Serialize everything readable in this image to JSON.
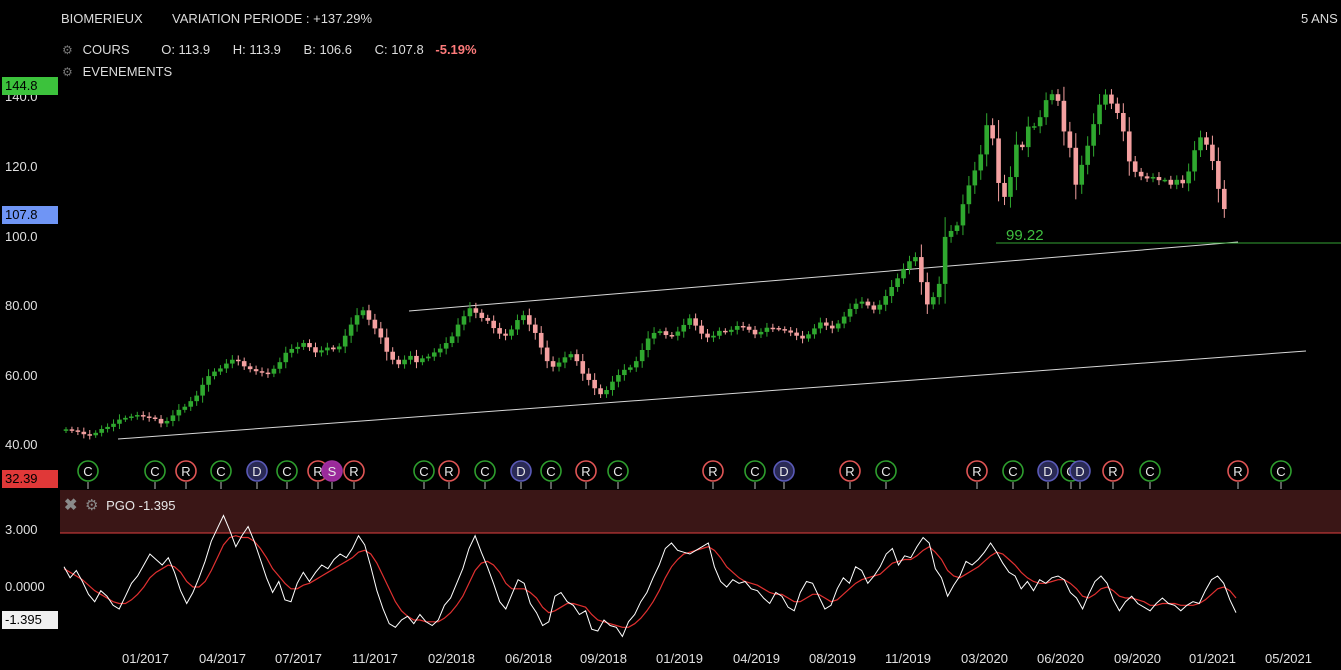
{
  "header": {
    "ticker": "BIOMERIEUX",
    "variation": "VARIATION PERIODE : +137.29%",
    "period": "5 ANS"
  },
  "legend": {
    "cours_label": "COURS",
    "open": "O: 113.9",
    "high": "H: 113.9",
    "low": "B: 106.6",
    "close": "C: 107.8",
    "change": "-5.19%",
    "events_label": "EVENEMENTS"
  },
  "price_axis": {
    "ticks": [
      "140.0",
      "120.0",
      "100.0",
      "80.00",
      "60.00",
      "40.00"
    ],
    "high_tag": "144.8",
    "last_tag": "107.8",
    "low_tag": "32.39",
    "level_label": "99.22"
  },
  "pgo_panel": {
    "label": "PGO -1.395",
    "ticks": [
      "3.000",
      "0.0000"
    ],
    "value_tag": "-1.395"
  },
  "time_axis": [
    "01/2017",
    "04/2017",
    "07/2017",
    "11/2017",
    "02/2018",
    "06/2018",
    "09/2018",
    "01/2019",
    "04/2019",
    "08/2019",
    "11/2019",
    "03/2020",
    "06/2020",
    "09/2020",
    "01/2021",
    "05/2021"
  ],
  "colors": {
    "up": "#2fa82f",
    "down": "#f4a0a0",
    "pgo_line": "#ffffff",
    "pgo_signal": "#e03030",
    "band": "#3a1616",
    "event_c": "#2e9e2e",
    "event_r": "#e05555",
    "event_d": "#5a5ab8",
    "event_s": "#a030a0"
  },
  "chart_data": {
    "type": "candlestick",
    "title": "BIOMERIEUX",
    "period": "5 ANS",
    "y_axis": {
      "ticks": [
        140,
        120,
        100,
        80,
        60,
        40
      ],
      "range": [
        32.39,
        144.8
      ]
    },
    "x_axis": {
      "labels": [
        "01/2017",
        "04/2017",
        "07/2017",
        "11/2017",
        "02/2018",
        "06/2018",
        "09/2018",
        "01/2019",
        "04/2019",
        "08/2019",
        "11/2019",
        "03/2020",
        "06/2020",
        "09/2020",
        "01/2021",
        "05/2021"
      ]
    },
    "last_candle": {
      "open": 113.9,
      "high": 113.9,
      "low": 106.6,
      "close": 107.8,
      "change_pct": -5.19
    },
    "variation_pct": 137.29,
    "horizontal_level": 99.22,
    "weekly_close": [
      44.5,
      44.2,
      43.8,
      43.1,
      42.8,
      43.5,
      44.6,
      45.2,
      46.1,
      47.3,
      47.8,
      48.2,
      48.6,
      48.2,
      47.9,
      47.5,
      46.2,
      46.9,
      48.5,
      50.1,
      51.0,
      52.6,
      54.2,
      57.3,
      59.8,
      61.1,
      62.0,
      63.4,
      64.5,
      64.1,
      62.6,
      61.8,
      61.2,
      60.8,
      60.5,
      61.9,
      63.8,
      66.5,
      67.6,
      68.2,
      69.3,
      68.1,
      66.6,
      67.2,
      68.0,
      67.5,
      68.3,
      71.4,
      74.6,
      77.3,
      78.7,
      76.0,
      73.5,
      70.9,
      66.8,
      64.5,
      63.2,
      64.5,
      65.6,
      63.8,
      64.9,
      65.4,
      66.6,
      67.7,
      69.3,
      71.2,
      74.6,
      77.0,
      79.3,
      78.0,
      76.5,
      75.7,
      73.6,
      72.0,
      71.4,
      73.2,
      75.9,
      77.3,
      74.6,
      72.2,
      68.0,
      64.1,
      62.5,
      63.7,
      65.2,
      66.1,
      64.1,
      60.5,
      58.7,
      56.3,
      54.6,
      55.8,
      58.2,
      60.1,
      61.6,
      62.3,
      64.1,
      67.3,
      70.6,
      72.2,
      72.7,
      71.6,
      71.4,
      72.6,
      74.5,
      76.4,
      74.3,
      72.0,
      70.9,
      71.4,
      72.8,
      72.5,
      73.1,
      74.2,
      74.0,
      73.1,
      71.8,
      72.5,
      73.7,
      73.6,
      73.3,
      72.9,
      72.3,
      71.4,
      70.6,
      71.8,
      73.5,
      75.2,
      74.3,
      73.5,
      74.9,
      76.9,
      79.1,
      80.6,
      81.2,
      80.1,
      78.9,
      80.3,
      82.8,
      85.4,
      87.9,
      90.6,
      92.8,
      94.0,
      86.8,
      80.4,
      82.5,
      86.3,
      99.8,
      101.5,
      103.1,
      109.2,
      114.6,
      118.9,
      123.5,
      131.9,
      128.1,
      115.3,
      111.3,
      117.0,
      126.3,
      125.6,
      131.5,
      131.6,
      134.2,
      139.1,
      140.8,
      138.9,
      130.1,
      125.4,
      114.8,
      120.5,
      126.0,
      132.2,
      137.8,
      140.7,
      138.1,
      135.4,
      130.1,
      121.5,
      118.5,
      117.2,
      116.6,
      117.0,
      116.1,
      116.2,
      114.8,
      116.2,
      115.2,
      118.6,
      124.7,
      128.4,
      126.3,
      121.6,
      113.6,
      107.8
    ],
    "trendlines": [
      {
        "from": {
          "date": "01/2017",
          "price": 42.0
        },
        "to": {
          "date": "05/2021",
          "price": 67.0
        }
      },
      {
        "from": {
          "date": "11/2017",
          "price": 79.6
        },
        "to": {
          "date": "01/2021",
          "price": 98.4
        }
      }
    ],
    "events": [
      "C",
      "C",
      "R",
      "C",
      "D",
      "C",
      "R",
      "S",
      "R",
      "C",
      "R",
      "C",
      "D",
      "C",
      "R",
      "C",
      "R",
      "C",
      "D",
      "R",
      "C",
      "R",
      "C",
      "D",
      "C",
      "D",
      "R",
      "C",
      "R",
      "C"
    ],
    "indicator": {
      "name": "PGO",
      "value": -1.395,
      "ticks": [
        3.0,
        0.0
      ],
      "pgo": [
        1.1,
        0.5,
        0.9,
        0.3,
        -0.4,
        -0.8,
        -0.2,
        -0.5,
        -1.0,
        -1.2,
        -0.5,
        0.2,
        0.6,
        1.2,
        1.8,
        1.5,
        1.2,
        1.6,
        0.8,
        -0.2,
        -0.9,
        -0.3,
        0.5,
        1.4,
        2.5,
        3.2,
        3.9,
        3.1,
        2.2,
        2.8,
        3.3,
        2.5,
        1.5,
        0.5,
        -0.3,
        0.3,
        -0.7,
        -0.8,
        0.2,
        0.8,
        0.3,
        0.8,
        1.2,
        1.0,
        1.5,
        1.8,
        1.6,
        2.1,
        2.8,
        2.3,
        1.1,
        -0.2,
        -1.2,
        -2.0,
        -2.2,
        -1.8,
        -1.6,
        -2.0,
        -1.5,
        -1.9,
        -2.1,
        -1.8,
        -1.0,
        -0.6,
        0.2,
        1.0,
        2.1,
        2.8,
        1.9,
        1.1,
        0.2,
        -0.8,
        -1.2,
        -0.4,
        0.4,
        0.2,
        -0.9,
        -1.4,
        -2.1,
        -1.9,
        -0.5,
        -0.3,
        -0.8,
        -1.0,
        -1.5,
        -1.3,
        -2.3,
        -2.4,
        -1.8,
        -2.1,
        -2.2,
        -2.7,
        -1.9,
        -1.5,
        -0.8,
        -0.3,
        0.5,
        1.2,
        2.1,
        2.4,
        2.0,
        1.9,
        1.8,
        2.0,
        2.2,
        2.4,
        1.1,
        0.3,
        0.0,
        0.4,
        0.2,
        0.3,
        -0.1,
        -0.2,
        -0.6,
        -0.9,
        -0.3,
        -0.5,
        -1.1,
        -1.3,
        -0.3,
        0.3,
        0.2,
        -0.5,
        -1.2,
        -1.0,
        -0.1,
        0.5,
        0.2,
        1.1,
        0.9,
        0.2,
        0.6,
        1.1,
        1.8,
        2.1,
        1.2,
        1.7,
        1.6,
        2.2,
        2.7,
        2.4,
        1.0,
        0.5,
        -0.5,
        0.1,
        0.6,
        1.4,
        1.2,
        1.5,
        1.9,
        2.4,
        1.9,
        1.3,
        0.8,
        0.6,
        -0.1,
        0.3,
        -0.2,
        0.4,
        0.2,
        0.5,
        0.6,
        0.4,
        -0.3,
        -0.6,
        -1.2,
        -0.4,
        0.3,
        0.6,
        0.2,
        -0.7,
        -1.3,
        -0.8,
        -0.5,
        -0.9,
        -1.1,
        -1.3,
        -0.9,
        -0.6,
        -0.9,
        -1.0,
        -1.3,
        -1.0,
        -0.8,
        -0.9,
        -0.2,
        0.4,
        0.6,
        0.2,
        -0.7,
        -1.395
      ],
      "signal": [
        1.0,
        0.8,
        0.6,
        0.4,
        0.1,
        -0.2,
        -0.4,
        -0.6,
        -0.8,
        -0.9,
        -0.9,
        -0.7,
        -0.4,
        0.0,
        0.5,
        0.8,
        1.0,
        1.2,
        1.1,
        0.8,
        0.3,
        0.0,
        0.0,
        0.3,
        0.9,
        1.6,
        2.3,
        2.7,
        2.8,
        2.7,
        2.7,
        2.5,
        2.1,
        1.6,
        1.0,
        0.6,
        0.2,
        -0.1,
        -0.1,
        0.1,
        0.2,
        0.4,
        0.6,
        0.8,
        1.0,
        1.2,
        1.4,
        1.6,
        1.9,
        2.0,
        1.8,
        1.3,
        0.6,
        -0.1,
        -0.8,
        -1.3,
        -1.6,
        -1.8,
        -1.8,
        -1.9,
        -1.9,
        -1.9,
        -1.7,
        -1.4,
        -1.0,
        -0.5,
        0.2,
        0.9,
        1.3,
        1.4,
        1.2,
        0.8,
        0.2,
        -0.1,
        -0.1,
        -0.1,
        -0.3,
        -0.6,
        -1.1,
        -1.4,
        -1.3,
        -1.1,
        -0.9,
        -0.9,
        -1.0,
        -1.1,
        -1.5,
        -1.8,
        -1.9,
        -2.0,
        -2.1,
        -2.2,
        -2.2,
        -2.0,
        -1.7,
        -1.3,
        -0.8,
        -0.2,
        0.5,
        1.1,
        1.5,
        1.8,
        1.9,
        2.0,
        2.1,
        2.2,
        2.0,
        1.6,
        1.1,
        0.8,
        0.5,
        0.3,
        0.2,
        0.1,
        -0.1,
        -0.3,
        -0.4,
        -0.4,
        -0.6,
        -0.8,
        -0.8,
        -0.6,
        -0.4,
        -0.4,
        -0.6,
        -0.8,
        -0.7,
        -0.4,
        -0.1,
        0.2,
        0.4,
        0.5,
        0.6,
        0.7,
        1.0,
        1.3,
        1.4,
        1.5,
        1.5,
        1.7,
        2.0,
        2.2,
        1.9,
        1.5,
        0.9,
        0.6,
        0.5,
        0.7,
        0.9,
        1.1,
        1.4,
        1.7,
        1.9,
        1.8,
        1.5,
        1.2,
        0.8,
        0.5,
        0.3,
        0.2,
        0.2,
        0.3,
        0.4,
        0.4,
        0.2,
        -0.1,
        -0.5,
        -0.6,
        -0.4,
        -0.1,
        0.0,
        -0.2,
        -0.5,
        -0.6,
        -0.6,
        -0.7,
        -0.8,
        -1.0,
        -1.0,
        -0.9,
        -0.9,
        -0.9,
        -1.0,
        -1.0,
        -1.0,
        -0.9,
        -0.7,
        -0.4,
        -0.1,
        0.0,
        -0.2,
        -0.6
      ]
    }
  }
}
